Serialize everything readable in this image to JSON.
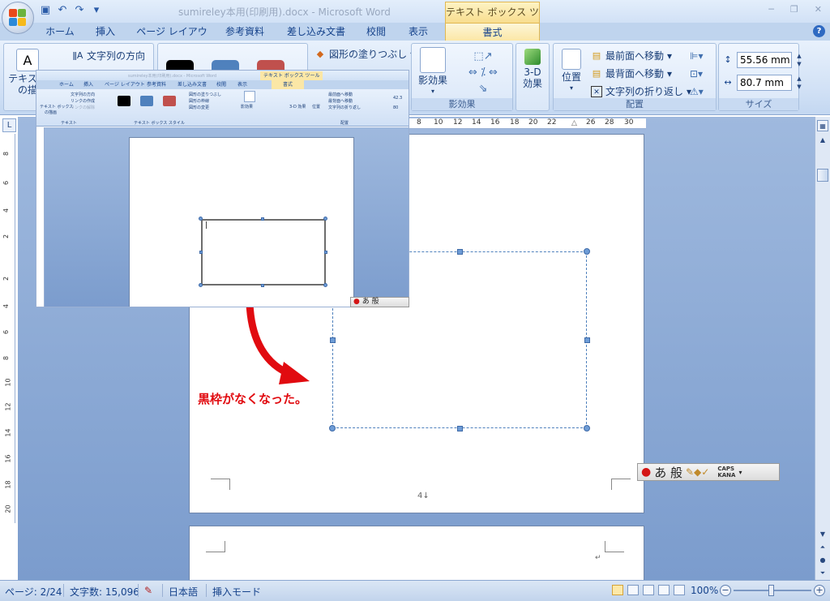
{
  "window": {
    "title": "sumireley本用(印刷用).docx - Microsoft Word",
    "context_tab_title": "テキスト ボックス ツール"
  },
  "ribbon_tabs": [
    "ホーム",
    "挿入",
    "ページ レイアウト",
    "参考資料",
    "差し込み文書",
    "校閲",
    "表示",
    "書式"
  ],
  "ribbon": {
    "text_group": {
      "textbox_label": "テキスト",
      "textbox_label2": "の描",
      "text_direction": "文字列の方向",
      "icon_text": "A"
    },
    "shape_fill": "図形の塗りつぶし",
    "shadow_effects": {
      "button": "影効果",
      "group_label": "影効果"
    },
    "three_d": {
      "line1": "3-D",
      "line2": "効果"
    },
    "arrange": {
      "position": "位置",
      "bring_front": "最前面へ移動",
      "send_back": "最背面へ移動",
      "text_wrap": "文字列の折り返し",
      "group_label": "配置"
    },
    "size": {
      "height": "55.56 mm",
      "width": "80.7 mm",
      "group_label": "サイズ"
    }
  },
  "ruler": {
    "ticks": [
      "8",
      "10",
      "12",
      "14",
      "16",
      "18",
      "20",
      "22",
      "26",
      "28",
      "30"
    ],
    "vticks": [
      "8",
      "6",
      "4",
      "2",
      "2",
      "4",
      "6",
      "8",
      "10",
      "12",
      "14",
      "16",
      "18",
      "20"
    ]
  },
  "document": {
    "caption": "黒枠がなくなった。",
    "page_number": "4↓",
    "page2_mark": "↵"
  },
  "inset": {
    "title": "sumireley本用(印刷用).docx - Microsoft Word",
    "context_tab": "テキスト ボックス ツール",
    "tabs": [
      "ホーム",
      "挿入",
      "ページ レイアウト",
      "参考資料",
      "差し込み文書",
      "校閲",
      "表示",
      "書式"
    ],
    "text_direction": "文字列の方向",
    "link_create": "リンクの作成",
    "link_break": "リンクの解除",
    "textbox_label": "テキスト ボックス",
    "draw": "の描画",
    "group_text": "テキスト",
    "group_style": "テキスト ボックス スタイル",
    "shape_fill": "図形の塗りつぶし",
    "shape_outline": "図形の枠線",
    "shape_change": "図形の変更",
    "shadow": "影効果",
    "three_d": "3-D 効果",
    "position": "位置",
    "bring_front": "最前面へ移動",
    "send_back": "最背面へ移動",
    "text_wrap": "文字列の折り返し",
    "group_arrange": "配置",
    "size_val": "42.3",
    "size_val2": "80"
  },
  "ime": {
    "text": "あ 般",
    "caps": "CAPS",
    "kana": "KANA",
    "small_text": "あ 般"
  },
  "statusbar": {
    "page": "ページ: 2/24",
    "word_count": "文字数: 15,096",
    "language": "日本語",
    "mode": "挿入モード",
    "zoom": "100%"
  },
  "colors": {
    "accent": "#15428b",
    "caption_red": "#e10b10",
    "swatch_black": "#000000",
    "swatch_blue": "#4f81bd",
    "swatch_red": "#c0504d"
  }
}
